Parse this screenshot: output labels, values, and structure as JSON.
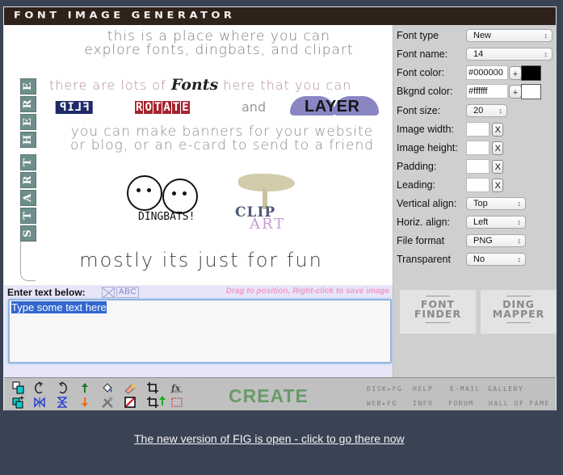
{
  "app": {
    "title": "Font Image Generator"
  },
  "preview": {
    "line1": "This is a place where you can explore fonts, dingbats, and clipart",
    "line2_before": "There are lots of ",
    "line2_emphasis": "Fonts",
    "line2_after": " here that you can",
    "flip_word": "FLIP",
    "rotate_letters": [
      "R",
      "O",
      "T",
      "A",
      "T",
      "E"
    ],
    "and_word": "and",
    "layer_word": "LAYER",
    "line4": "You can make banners for your website or blog, or an e-card to send to a friend",
    "start_here_letters": [
      "S",
      "T",
      "A",
      "R",
      "T",
      "H",
      "E",
      "R",
      "E"
    ],
    "dingbats_label": "DINGBATS!",
    "clip_word": "CLIP",
    "art_word": "ART",
    "line5": "mostly its just for fun"
  },
  "input": {
    "label": "Enter text below:",
    "clear_icon": "clear-icon",
    "abc_label": "ABC",
    "hint": "Drag to position, Right-click to save image",
    "value": "Type some text here"
  },
  "settings": {
    "font_type": {
      "label": "Font type",
      "value": "New"
    },
    "font_name": {
      "label": "Font name:",
      "value": "14"
    },
    "font_color": {
      "label": "Font color:",
      "value": "#000000",
      "swatch": "#000000",
      "plus": "+"
    },
    "bkgnd_color": {
      "label": "Bkgnd color:",
      "value": "#ffffff",
      "swatch": "#ffffff",
      "plus": "+"
    },
    "font_size": {
      "label": "Font size:",
      "value": "20"
    },
    "image_width": {
      "label": "Image width:",
      "value": "",
      "clear": "X"
    },
    "image_height": {
      "label": "Image height:",
      "value": "",
      "clear": "X"
    },
    "padding": {
      "label": "Padding:",
      "value": "",
      "clear": "X"
    },
    "leading": {
      "label": "Leading:",
      "value": "",
      "clear": "X"
    },
    "vertical_align": {
      "label": "Vertical align:",
      "value": "Top"
    },
    "horiz_align": {
      "label": "Horiz. align:",
      "value": "Left"
    },
    "file_format": {
      "label": "File format",
      "value": "PNG"
    },
    "transparent": {
      "label": "Transparent",
      "value": "No"
    },
    "font_finder": {
      "line1": "Font",
      "line2": "Finder"
    },
    "ding_mapper": {
      "line1": "Ding",
      "line2": "Mapper"
    }
  },
  "toolbar": {
    "tools_row1": [
      "duplicate-icon",
      "rotate-left-icon",
      "rotate-right-icon",
      "move-up-icon",
      "fill-color-icon",
      "eraser-icon",
      "crop-icon",
      "font-style-icon"
    ],
    "tools_row2": [
      "add-layer-icon",
      "flip-horizontal-icon",
      "flip-vertical-icon",
      "move-down-icon",
      "tools-icon",
      "no-background-icon",
      "crop-up-icon",
      "select-area-icon"
    ],
    "create_label": "CREATE",
    "links_row1": [
      "DISK▸FG",
      "HELP",
      "E-MAIL",
      "GALLERY"
    ],
    "links_row2": [
      "WEB▸FG",
      "INFO",
      "FORUM",
      "HALL OF FAME"
    ]
  },
  "notice": {
    "text": "The new version of FIG is open - click to go there now"
  }
}
